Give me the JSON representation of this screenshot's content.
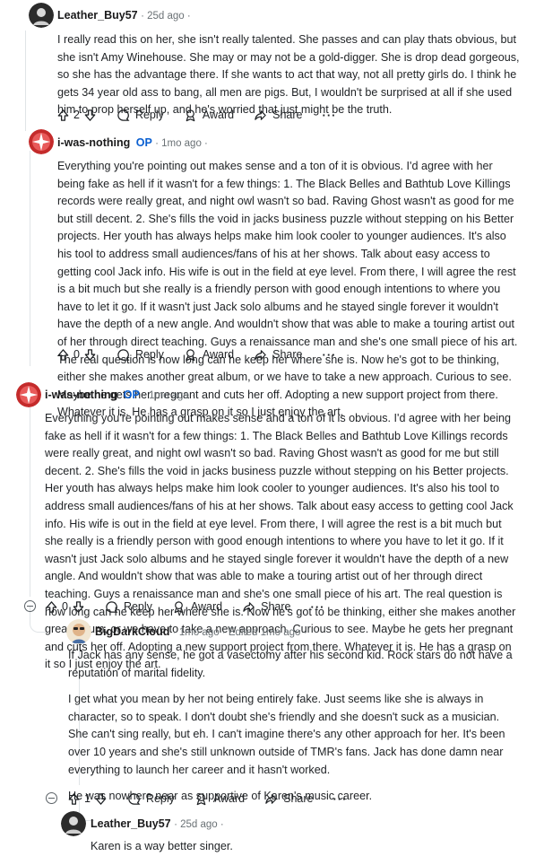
{
  "colors": {
    "op_badge": "#0a5fd1",
    "thread_line": "#e0e4e7",
    "meta": "#6a7175"
  },
  "comments": [
    {
      "author": "Leather_Buy57",
      "op": "",
      "meta": "· 25d ago ·",
      "body": [
        "I really read this on her, she isn't really talented. She passes and can play thats obvious, but she isn't Amy Winehouse. She may or may not be a gold-digger. She is drop dead gorgeous, so she has the advantage there. If she wants to act that way, not all pretty girls do. I think he gets 34 year old ass to bang, all men are pigs. But, I wouldn't be surprised at all if she used him to prop herself up, and he's worried that just might be the truth."
      ],
      "votes": "2",
      "reply": "Reply",
      "award": "Award",
      "share": "Share",
      "more": "···"
    },
    {
      "author": "i-was-nothing",
      "op": "OP",
      "meta": "· 1mo ago ·",
      "body": [
        "Everything you're pointing out makes sense and a ton of it is obvious. I'd agree with her being fake as hell if it wasn't for a few things: 1. The Black Belles and Bathtub Love Killings records were really great, and night owl wasn't so bad. Raving Ghost wasn't as good for me but still decent. 2. She's fills the void in jacks business puzzle without stepping on his Better projects. Her youth has always helps make him look cooler to younger audiences. It's also his tool to address small audiences/fans of his at her shows. Talk about easy access to getting cool Jack info. His wife is out in the field at eye level. From there, I will agree the rest is a bit much but she really is a friendly person with good enough intentions to where you have to let it go. If it wasn't just Jack solo albums and he stayed single forever it wouldn't have the depth of a new angle. And wouldn't show that was able to make a touring artist out of her through direct teaching. Guys a renaissance man and she's one small piece of his art. The real question is how long can he keep her where she is. Now he's got to be thinking, either she makes another great album, or we have to take a new approach. Curious to see. Maybe he gets her pregnant and cuts her off. Adopting a new support project from there. Whatever it is. He has a grasp on it so I just enjoy the art."
      ],
      "votes": "0",
      "reply": "Reply",
      "award": "Award",
      "share": "Share",
      "more": "···"
    },
    {
      "author": "i-was-nothing",
      "op": "OP",
      "meta": "· 1mo ago ·",
      "body": [
        "Everything you're pointing out makes sense and a ton of it is obvious. I'd agree with her being fake as hell if it wasn't for a few things: 1. The Black Belles and Bathtub Love Killings records were really great, and night owl wasn't so bad. Raving Ghost wasn't as good for me but still decent. 2. She's fills the void in jacks business puzzle without stepping on his Better projects. Her youth has always helps make him look cooler to younger audiences. It's also his tool to address small audiences/fans of his at her shows. Talk about easy access to getting cool Jack info. His wife is out in the field at eye level. From there, I will agree the rest is a bit much but she really is a friendly person with good enough intentions to where you have to let it go. If it wasn't just Jack solo albums and he stayed single forever it wouldn't have the depth of a new angle. And wouldn't show that was able to make a touring artist out of her through direct teaching. Guys a renaissance man and she's one small piece of his art. The real question is how long can he keep her where she is. Now he's got to be thinking, either she makes another great album, or we have to take a new approach. Curious to see. Maybe he gets her pregnant and cuts her off. Adopting a new support project from there. Whatever it is. He has a grasp on it so I just enjoy the art."
      ],
      "votes": "0",
      "reply": "Reply",
      "award": "Award",
      "share": "Share",
      "more": "···"
    },
    {
      "author": "BigDarkCloud",
      "op": "",
      "meta": "· 1mo ago · Edited 1mo ago ·",
      "body": [
        "If Jack has any sense, he got a vasectomy after his second kid. Rock stars do not have a reputation of marital fidelity.",
        "I get what you mean by her not being entirely fake. Just seems like she is always in character, so to speak. I don't doubt she's friendly and she doesn't suck as a musician. She can't sing really, but eh. I can't imagine there's any other approach for her. It's been over 10 years and she's still unknown outside of TMR's fans. Jack has done damn near everything to launch her career and it hasn't worked.",
        "He was nowhere near as supportive of Karen's music career."
      ],
      "votes": "1",
      "reply": "Reply",
      "award": "Award",
      "share": "Share",
      "more": "···"
    },
    {
      "author": "Leather_Buy57",
      "op": "",
      "meta": "· 25d ago ·",
      "body": [
        "Karen is a way better singer."
      ]
    }
  ]
}
